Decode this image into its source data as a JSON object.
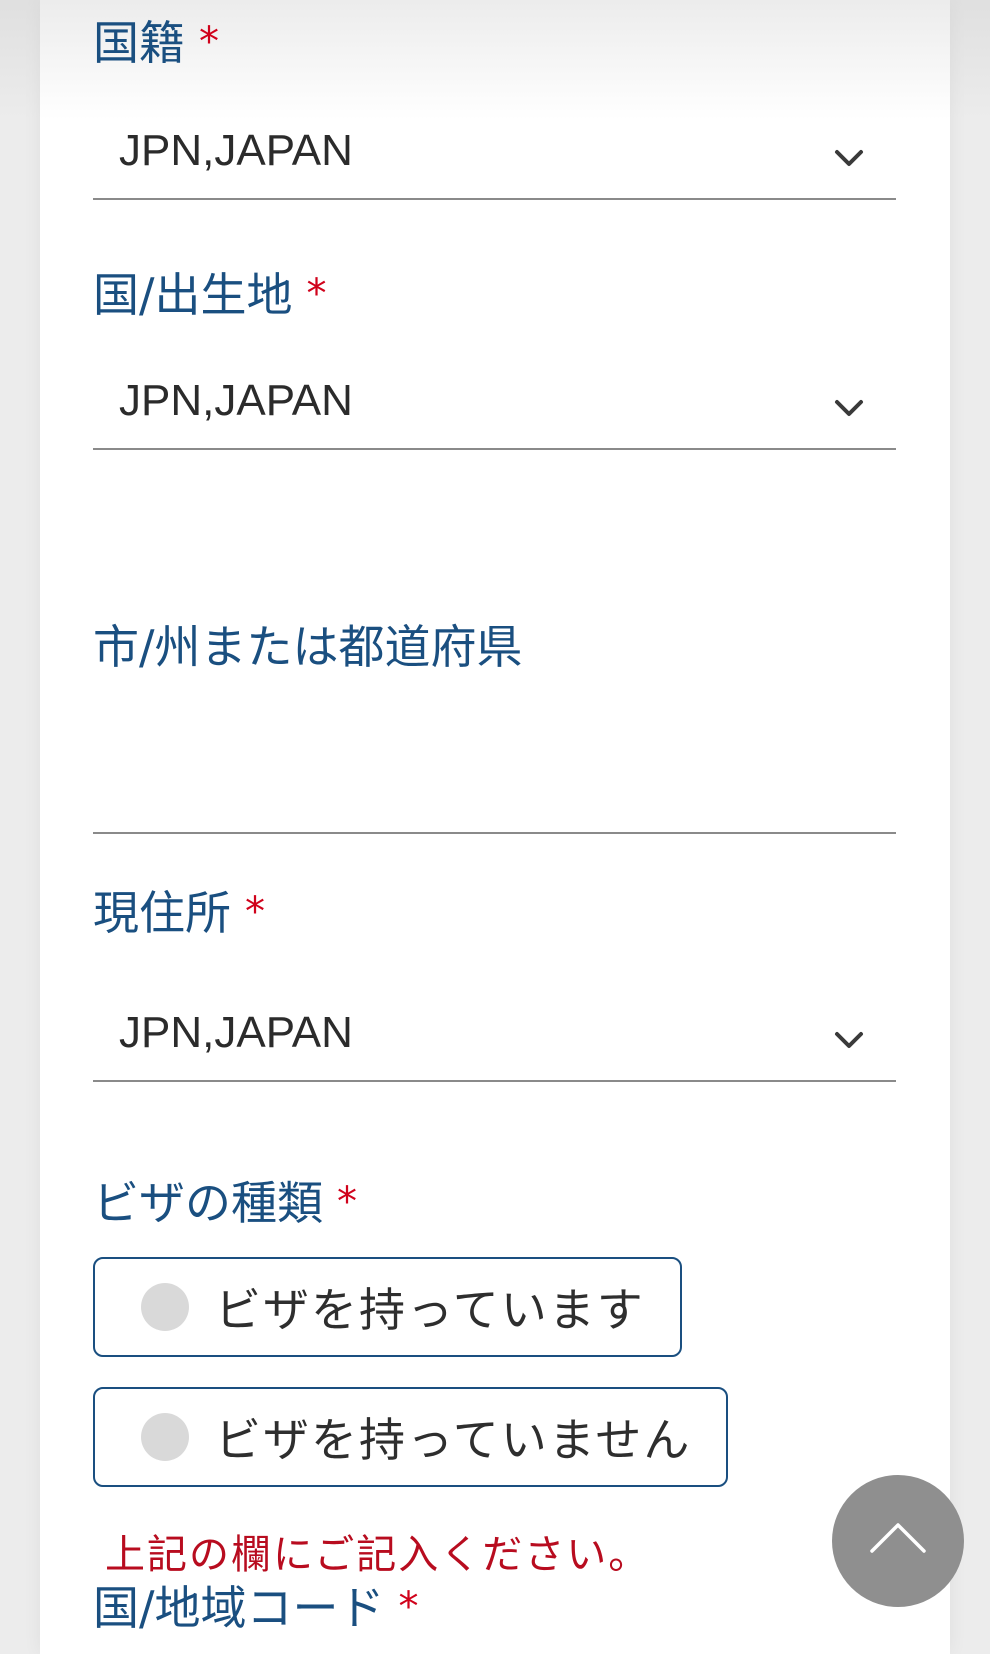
{
  "form": {
    "nationality": {
      "label": "国籍",
      "required_mark": "*",
      "value": "JPN,JAPAN"
    },
    "birth_country": {
      "label": "国/出生地",
      "required_mark": "*",
      "value": "JPN,JAPAN"
    },
    "birth_city": {
      "label": "市/州または都道府県",
      "value": ""
    },
    "residence": {
      "label": "現住所",
      "required_mark": "*",
      "value": "JPN,JAPAN"
    },
    "visa_type": {
      "label": "ビザの種類",
      "required_mark": "*",
      "options": [
        "ビザを持っています",
        "ビザを持っていません"
      ],
      "error": "上記の欄にご記入ください。"
    },
    "region_code": {
      "label": "国/地域コード",
      "required_mark": "*"
    }
  },
  "icons": {
    "dropdown": "chevron-down-icon",
    "scroll_top": "chevron-up-icon"
  },
  "colors": {
    "label": "#1a4f80",
    "required": "#d0021b",
    "error": "#b80c1f",
    "radio_border": "#1a4f80",
    "scroll_button": "#8f8f8f"
  }
}
